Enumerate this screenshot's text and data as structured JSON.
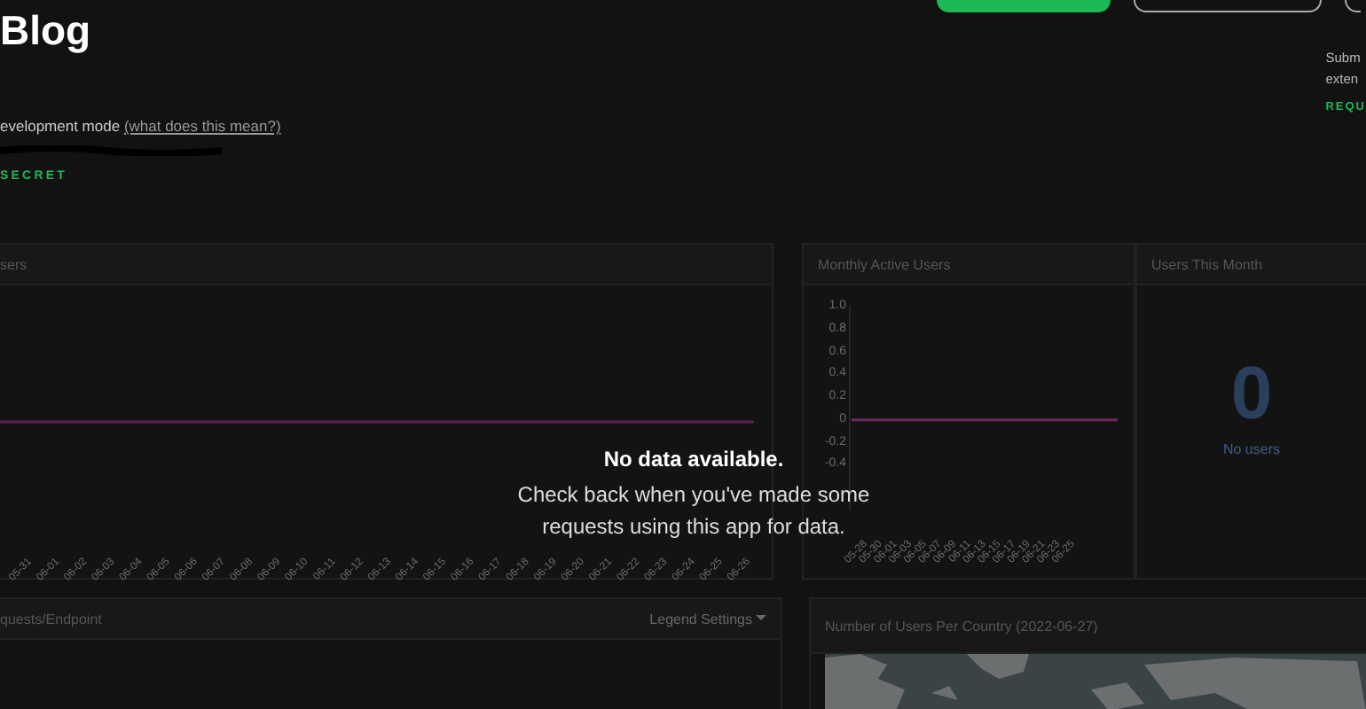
{
  "header": {
    "title": "Blog",
    "buttons": [
      {
        "kind": "primary"
      },
      {
        "kind": "outline"
      },
      {
        "kind": "outline"
      }
    ],
    "mode_note": {
      "text": "evelopment mode",
      "link": "(what does this mean?)"
    },
    "secret_link": "SECRET",
    "side_note": {
      "lines": [
        "Subm",
        "exten"
      ],
      "link": "REQU"
    }
  },
  "panels": [
    {
      "kind": "daily",
      "title": "sers",
      "x_labels": [
        "05-31",
        "06-01",
        "06-02",
        "06-03",
        "06-04",
        "06-05",
        "06-06",
        "06-07",
        "06-08",
        "06-09",
        "06-10",
        "06-11",
        "06-12",
        "06-13",
        "06-14",
        "06-15",
        "06-16",
        "06-17",
        "06-18",
        "06-19",
        "06-20",
        "06-21",
        "06-22",
        "06-23",
        "06-24",
        "06-25",
        "06-26"
      ]
    },
    {
      "kind": "chart",
      "title": "Monthly Active Users",
      "chart_data": {
        "type": "line",
        "categories": [
          "05-28",
          "05-30",
          "06-01",
          "06-03",
          "06-05",
          "06-07",
          "06-09",
          "06-11",
          "06-13",
          "06-15",
          "06-17",
          "06-19",
          "06-21",
          "06-23",
          "06-25"
        ],
        "values": [
          0,
          0,
          0,
          0,
          0,
          0,
          0,
          0,
          0,
          0,
          0,
          0,
          0,
          0,
          0
        ],
        "ylim": [
          -0.8,
          1.0
        ],
        "yticks": [
          {
            "value": 1,
            "label": "1.0"
          },
          {
            "value": 0.8,
            "label": "0.8"
          },
          {
            "value": 0.6,
            "label": "0.6"
          },
          {
            "value": 0.4,
            "label": "0.4"
          },
          {
            "value": 0.2,
            "label": "0.2"
          },
          {
            "value": 0,
            "label": "0"
          },
          {
            "value": -0.2,
            "label": "-0.2"
          },
          {
            "value": -0.4,
            "label": "-0.4"
          }
        ]
      }
    },
    {
      "kind": "stat",
      "title": "Users This Month",
      "value": "0",
      "caption": "No users"
    }
  ],
  "empty_state": {
    "title": "No data available.",
    "lines": [
      "Check back when you've made some",
      "requests using this app for data."
    ]
  },
  "bottom_panels": [
    {
      "kind": "legend",
      "title": "quests/Endpoint",
      "action": "Legend Settings"
    },
    {
      "kind": "map",
      "title": "Number of Users Per Country (2022-06-27)"
    }
  ]
}
